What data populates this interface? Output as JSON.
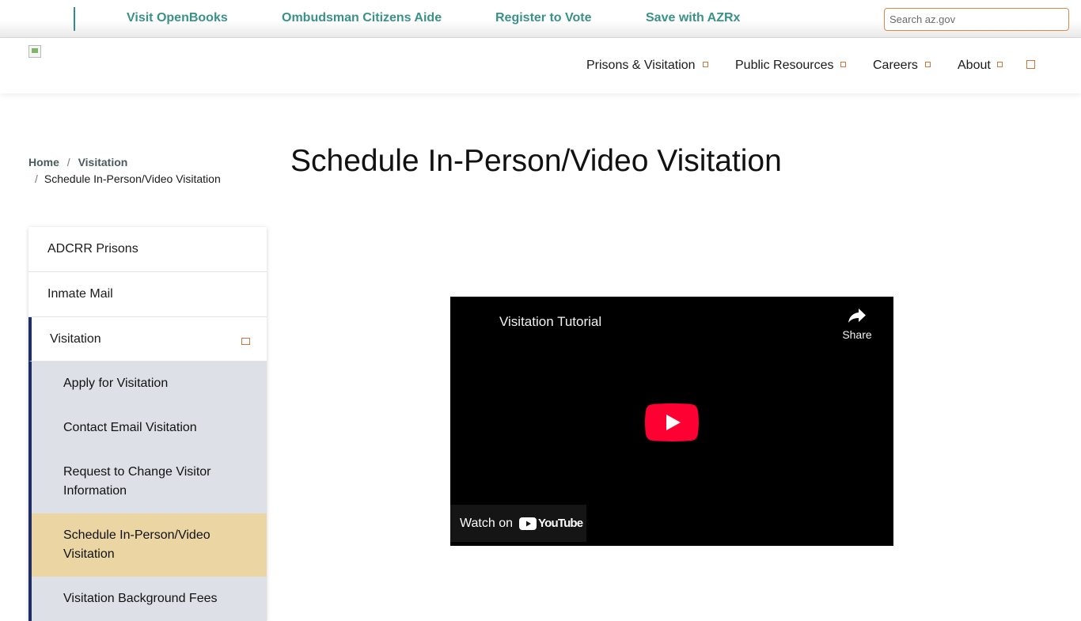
{
  "topbar": {
    "links": [
      {
        "label": "Visit OpenBooks"
      },
      {
        "label": "Ombudsman Citizens Aide"
      },
      {
        "label": "Register to Vote"
      },
      {
        "label": "Save with AZRx"
      }
    ],
    "search": {
      "placeholder": "Search az.gov",
      "value": ""
    }
  },
  "header": {
    "nav": [
      {
        "label": "Prisons & Visitation"
      },
      {
        "label": "Public Resources"
      },
      {
        "label": "Careers"
      },
      {
        "label": "About"
      }
    ]
  },
  "breadcrumb": {
    "home": "Home",
    "separator": "/",
    "section": "Visitation",
    "current": "Schedule In-Person/Video Visitation"
  },
  "page": {
    "title": "Schedule In-Person/Video Visitation"
  },
  "sidenav": {
    "items": [
      {
        "label": "ADCRR Prisons"
      },
      {
        "label": "Inmate Mail"
      },
      {
        "label": "Visitation"
      }
    ],
    "subitems": [
      {
        "label": "Apply for Visitation"
      },
      {
        "label": "Contact Email Visitation"
      },
      {
        "label": "Request to Change Visitor Information"
      },
      {
        "label": "Schedule In-Person/Video Visitation"
      },
      {
        "label": "Visitation Background Fees"
      }
    ]
  },
  "video": {
    "title": "Visitation Tutorial",
    "share_label": "Share",
    "watch_label": "Watch on",
    "brand_label": "YouTube",
    "play_color": "#ff0033"
  },
  "colors": {
    "link_teal": "#3a9188",
    "accent_orange": "#d1733c",
    "nav_blue": "#1f2f66",
    "subnav_bg": "#dde1e7",
    "subnav_active_bg": "#ead5a3"
  }
}
